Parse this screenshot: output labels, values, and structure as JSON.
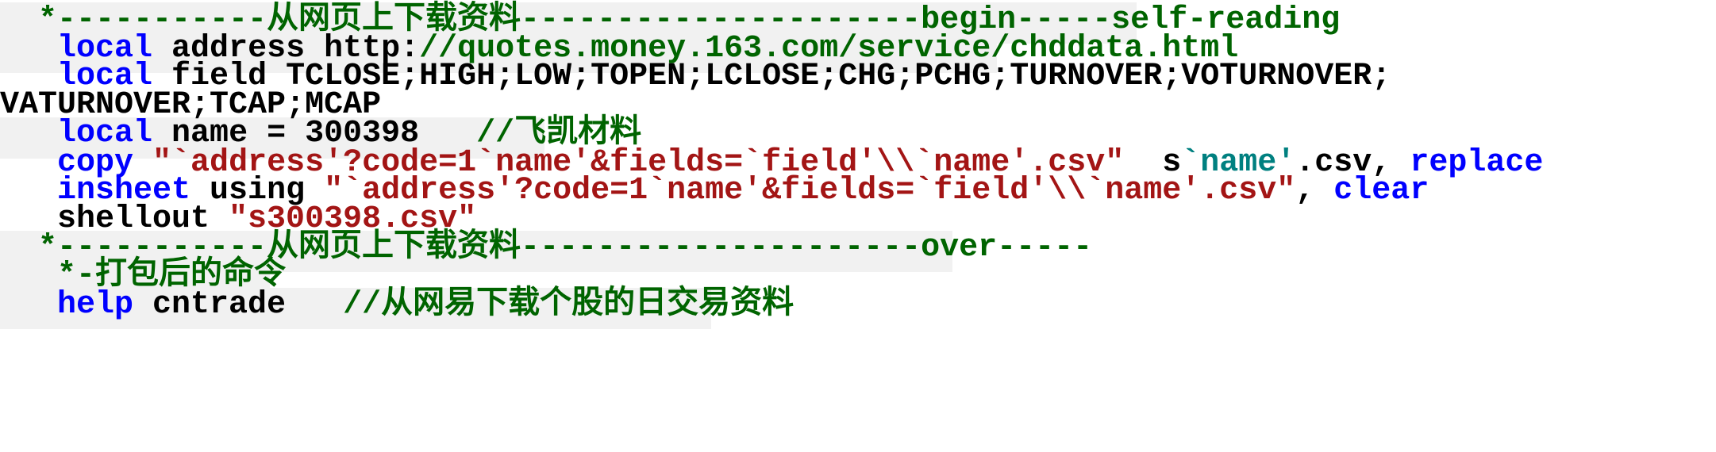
{
  "lines": [
    [
      {
        "t": "  ",
        "c": "txt"
      },
      {
        "t": "*-----------从网页上下载资料---------------------begin-----self-reading",
        "c": "cmt"
      }
    ],
    [
      {
        "t": "   ",
        "c": "txt"
      },
      {
        "t": "local",
        "c": "kw"
      },
      {
        "t": " address http:",
        "c": "txt"
      },
      {
        "t": "//quotes.money.163.com/service/chddata.html",
        "c": "cmt"
      }
    ],
    [
      {
        "t": "   ",
        "c": "txt"
      },
      {
        "t": "local",
        "c": "kw"
      },
      {
        "t": " field TCLOSE;HIGH;LOW;TOPEN;LCLOSE;CHG;PCHG;TURNOVER;VOTURNOVER;",
        "c": "txt"
      }
    ],
    [
      {
        "t": "VATURNOVER;TCAP;MCAP",
        "c": "txt"
      }
    ],
    [
      {
        "t": "   ",
        "c": "txt"
      },
      {
        "t": "local",
        "c": "kw"
      },
      {
        "t": " name = 300398   ",
        "c": "txt"
      },
      {
        "t": "//飞凯材料",
        "c": "cmt"
      }
    ],
    [
      {
        "t": "   ",
        "c": "txt"
      },
      {
        "t": "copy",
        "c": "kw"
      },
      {
        "t": " ",
        "c": "txt"
      },
      {
        "t": "\"`address'?code=1`name'&fields=`field'\\\\`name'.csv\"",
        "c": "str"
      },
      {
        "t": "  s",
        "c": "txt"
      },
      {
        "t": "`name'",
        "c": "mac"
      },
      {
        "t": ".csv, ",
        "c": "txt"
      },
      {
        "t": "replace",
        "c": "kw"
      }
    ],
    [
      {
        "t": "   ",
        "c": "txt"
      },
      {
        "t": "insheet",
        "c": "kw"
      },
      {
        "t": " using ",
        "c": "txt"
      },
      {
        "t": "\"`address'?code=1`name'&fields=`field'\\\\`name'.csv\"",
        "c": "str"
      },
      {
        "t": ", ",
        "c": "txt"
      },
      {
        "t": "clear",
        "c": "kw"
      }
    ],
    [
      {
        "t": "   shellout ",
        "c": "txt"
      },
      {
        "t": "\"s300398.csv\"",
        "c": "str"
      }
    ],
    [
      {
        "t": "  ",
        "c": "txt"
      },
      {
        "t": "*-----------从网页上下载资料---------------------over-----",
        "c": "cmt"
      }
    ],
    [
      {
        "t": "   ",
        "c": "txt"
      },
      {
        "t": "*-打包后的命令",
        "c": "cmt"
      }
    ],
    [
      {
        "t": "   ",
        "c": "txt"
      },
      {
        "t": "help",
        "c": "kw"
      },
      {
        "t": " cntrade   ",
        "c": "txt"
      },
      {
        "t": "//从网易下载个股的日交易资料",
        "c": "cmt"
      }
    ]
  ],
  "colors": {
    "comment": "#006400",
    "keyword": "#0000ff",
    "string": "#a31515",
    "macro": "#008080",
    "text": "#000000",
    "highlight": "#f1f1f1"
  }
}
